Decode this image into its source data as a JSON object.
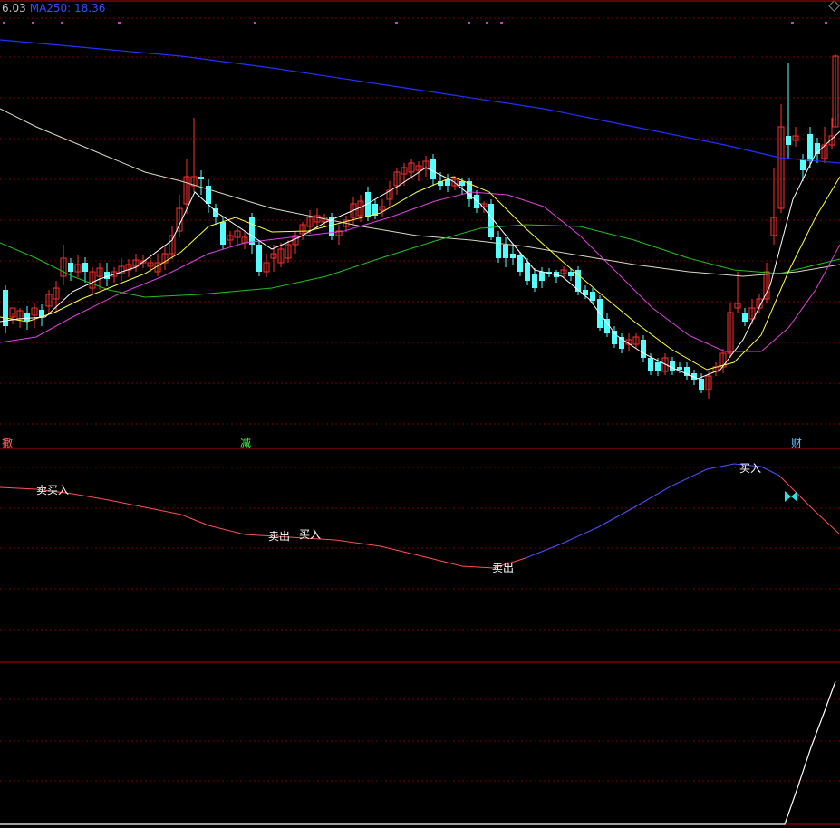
{
  "header": {
    "value_left": "6.03",
    "ma250_label": "MA250: 18.36"
  },
  "colors": {
    "bg": "#000000",
    "grid": "#7a0000",
    "panel_divider": "#c00000",
    "candle_up": "#ff3030",
    "candle_down": "#54ffff",
    "ma250": "#2030ff",
    "ma_long": "#d8d8c0",
    "ma_green": "#20c020",
    "ma_magenta": "#e040e0",
    "ma_yellow": "#ffff40",
    "ma_white": "#ffffff",
    "dots": "#c040c0",
    "osc_red": "#ff5050",
    "osc_blue": "#5050ff"
  },
  "event_markers": [
    {
      "text": "撤",
      "color": "#ff6060"
    },
    {
      "text": "减",
      "color": "#40ff40"
    },
    {
      "text": "财",
      "color": "#60c0ff"
    }
  ],
  "indicator_labels": [
    {
      "text": "卖买入"
    },
    {
      "text": "卖出"
    },
    {
      "text": "买入"
    },
    {
      "text": "卖出"
    },
    {
      "text": "买入"
    }
  ],
  "butterfly_icon": "butterfly-icon"
}
